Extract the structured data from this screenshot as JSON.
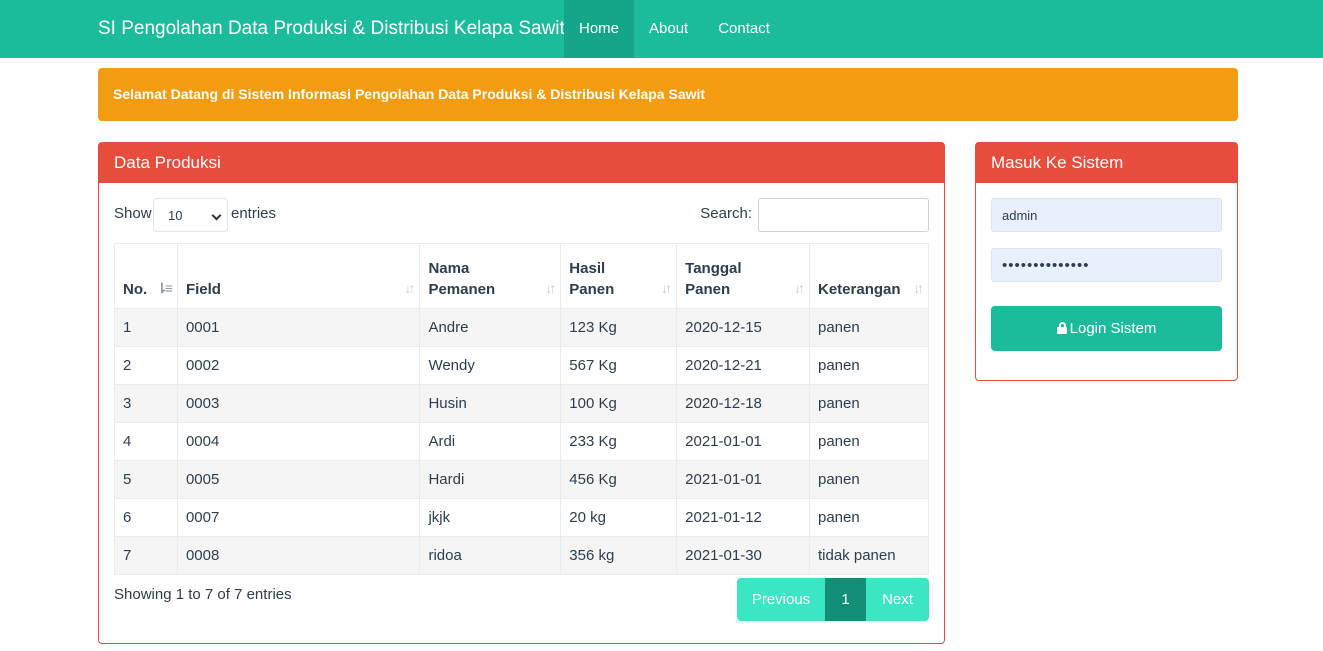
{
  "navbar": {
    "brand": "SI Pengolahan Data Produksi & Distribusi Kelapa Sawit",
    "items": [
      {
        "label": "Home"
      },
      {
        "label": "About"
      },
      {
        "label": "Contact"
      }
    ]
  },
  "alert": {
    "text": "Selamat Datang di Sistem Informasi Pengolahan Data Produksi & Distribusi Kelapa Sawit"
  },
  "produksi": {
    "title": "Data Produksi",
    "show_label": "Show",
    "page_size": "10",
    "entries_label": "entries",
    "search_label": "Search:",
    "search_value": "",
    "columns": [
      {
        "line1": "No.",
        "line2": ""
      },
      {
        "line1": "Field",
        "line2": ""
      },
      {
        "line1": "Nama",
        "line2": "Pemanen"
      },
      {
        "line1": "Hasil",
        "line2": "Panen"
      },
      {
        "line1": "Tanggal",
        "line2": "Panen"
      },
      {
        "line1": "Keterangan",
        "line2": ""
      }
    ],
    "rows": [
      [
        "1",
        "0001",
        "Andre",
        "123 Kg",
        "2020-12-15",
        "panen"
      ],
      [
        "2",
        "0002",
        "Wendy",
        "567 Kg",
        "2020-12-21",
        "panen"
      ],
      [
        "3",
        "0003",
        "Husin",
        "100 Kg",
        "2020-12-18",
        "panen"
      ],
      [
        "4",
        "0004",
        "Ardi",
        "233 Kg",
        "2021-01-01",
        "panen"
      ],
      [
        "5",
        "0005",
        "Hardi",
        "456 Kg",
        "2021-01-01",
        "panen"
      ],
      [
        "6",
        "0007",
        "jkjk",
        "20 kg",
        "2021-01-12",
        "panen"
      ],
      [
        "7",
        "0008",
        "ridoa",
        "356 kg",
        "2021-01-30",
        "tidak panen"
      ]
    ],
    "info": "Showing 1 to 7 of 7 entries",
    "pagination": {
      "previous": "Previous",
      "current": "1",
      "next": "Next"
    }
  },
  "login": {
    "title": "Masuk Ke Sistem",
    "username": "admin",
    "password_mask": "••••••••••••••",
    "button_label": "Login Sistem"
  },
  "colors": {
    "primary": "#1abc9c",
    "warning": "#f39c12",
    "danger": "#e74c3c"
  }
}
